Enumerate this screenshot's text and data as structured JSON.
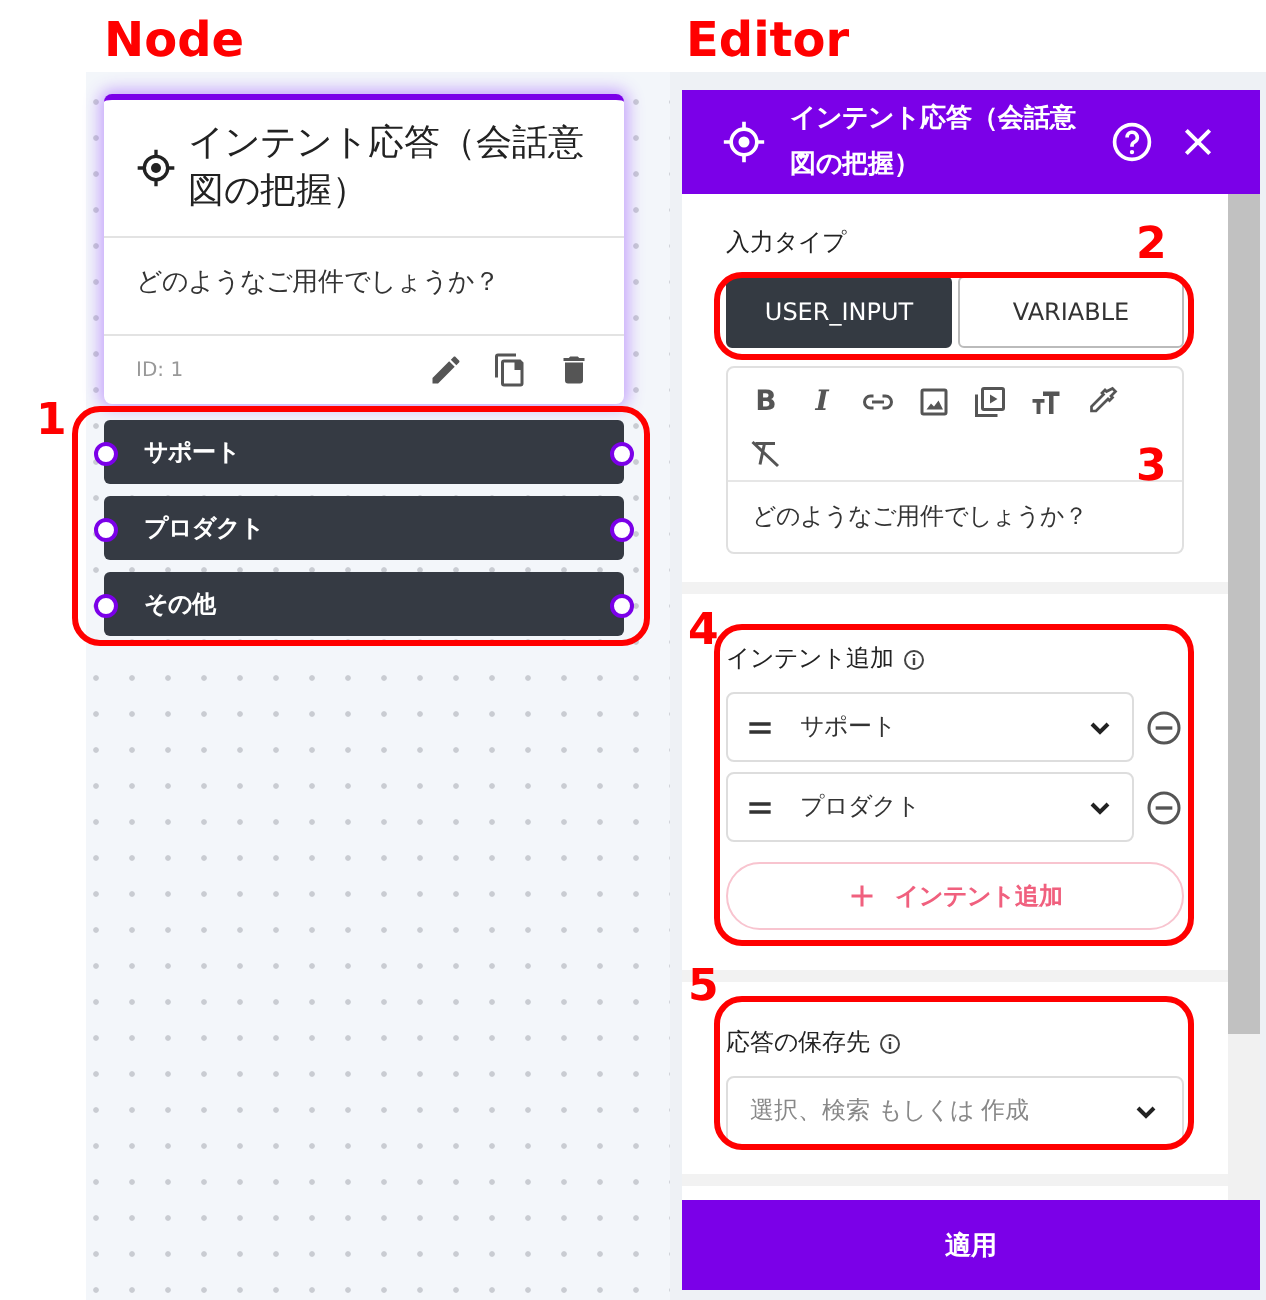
{
  "annotations": {
    "labels": [
      {
        "text": "Node"
      },
      {
        "text": "Editor"
      }
    ],
    "markers": [
      "1",
      "2",
      "3",
      "4",
      "5"
    ]
  },
  "node": {
    "title": "インテント応答（会話意図の把握）",
    "message": "どのようなご用件でしょうか？",
    "id_label": "ID: 1",
    "selected": true,
    "outputs": [
      {
        "label": "サポート"
      },
      {
        "label": "プロダクト"
      },
      {
        "label": "その他"
      }
    ]
  },
  "editor": {
    "title": "インテント応答（会話意図の把握）",
    "input_type": {
      "label": "入力タイプ",
      "options": [
        {
          "label": "USER_INPUT",
          "selected": true
        },
        {
          "label": "VARIABLE",
          "selected": false
        }
      ]
    },
    "toolbar_glyphs": [
      "B",
      "I"
    ],
    "message": "どのようなご用件でしょうか？",
    "intents": {
      "label": "インテント追加",
      "items": [
        {
          "value": "サポート"
        },
        {
          "value": "プロダクト"
        }
      ],
      "add_button": "インテント追加"
    },
    "save_to": {
      "label": "応答の保存先",
      "placeholder": "選択、検索 もしくは 作成"
    },
    "apply_button": "適用"
  }
}
